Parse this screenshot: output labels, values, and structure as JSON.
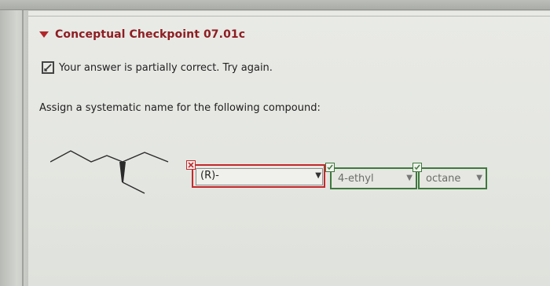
{
  "checkpoint": {
    "title": "Conceptual Checkpoint 07.01c",
    "expanded": true
  },
  "feedback": {
    "text": "Your answer is partially correct.  Try again.",
    "icon": "partial-check-icon"
  },
  "question": {
    "prompt": "Assign a systematic name for the following compound:"
  },
  "answer_fields": [
    {
      "selected": "(R)-",
      "status": "incorrect",
      "icon": "x-icon"
    },
    {
      "selected": "4-ethyl",
      "status": "correct",
      "icon": "check-icon"
    },
    {
      "selected": "octane",
      "status": "correct",
      "icon": "check-icon"
    }
  ],
  "colors": {
    "header_accent": "#b3262a",
    "incorrect": "#c4292c",
    "correct": "#3e7a3e"
  }
}
